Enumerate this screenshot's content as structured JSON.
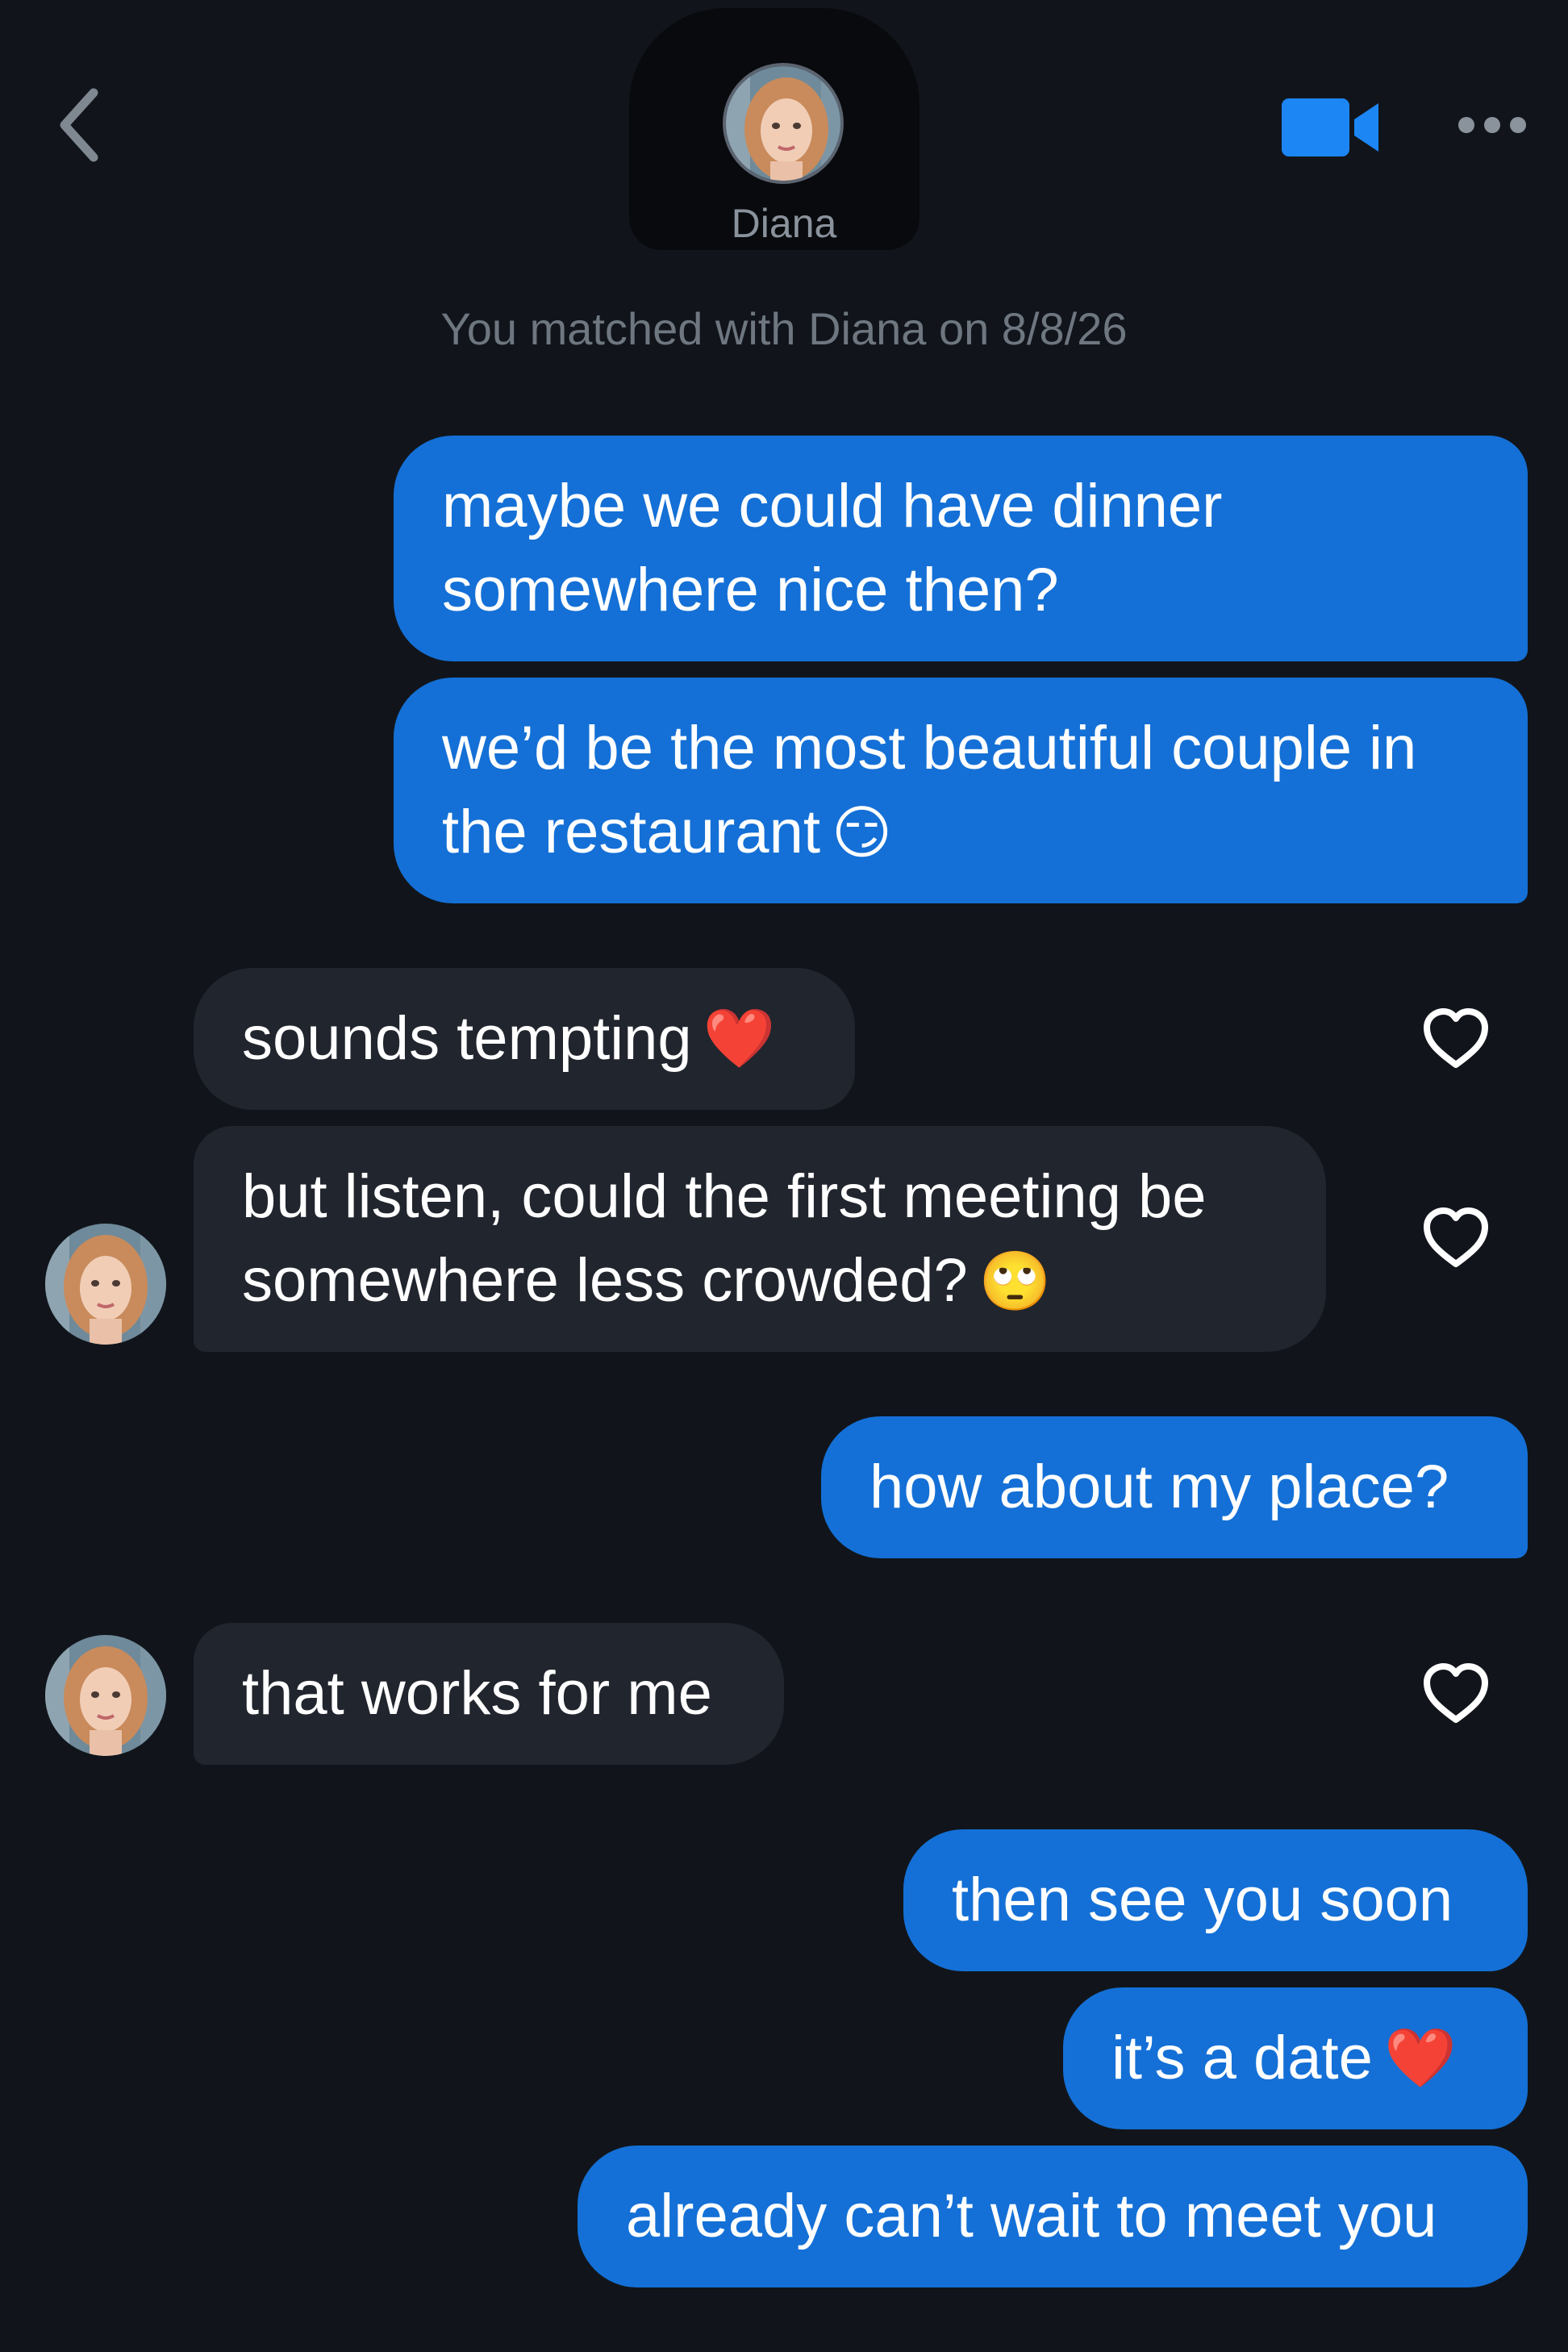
{
  "header": {
    "contact_name": "Diana",
    "match_notice": "You matched with Diana on 8/8/26",
    "accent_color": "#1d86f5"
  },
  "messages": [
    {
      "direction": "sent",
      "text": "maybe we could have dinner somewhere nice then?"
    },
    {
      "direction": "sent",
      "text": "we’d be the most beautiful couple in the restaurant",
      "emoji": "😏"
    },
    {
      "direction": "received",
      "text": "sounds tempting",
      "emoji": "❤️"
    },
    {
      "direction": "received",
      "text": "but listen, could the first meeting be somewhere less crowded?",
      "emoji": "🙄"
    },
    {
      "direction": "sent",
      "text": "how about my place?"
    },
    {
      "direction": "received",
      "text": "that works for me"
    },
    {
      "direction": "sent",
      "text": "then see you soon"
    },
    {
      "direction": "sent",
      "text": "it’s a date",
      "emoji": "❤️"
    },
    {
      "direction": "sent",
      "text": "already can’t wait to meet you"
    }
  ],
  "icons": {
    "back": "chevron-left-icon",
    "video": "video-camera-icon",
    "more": "more-horizontal-icon",
    "like": "heart-outline-icon"
  },
  "colors": {
    "background": "#11151b",
    "sent_bubble": "#1470d6",
    "received_bubble": "#21252d"
  }
}
